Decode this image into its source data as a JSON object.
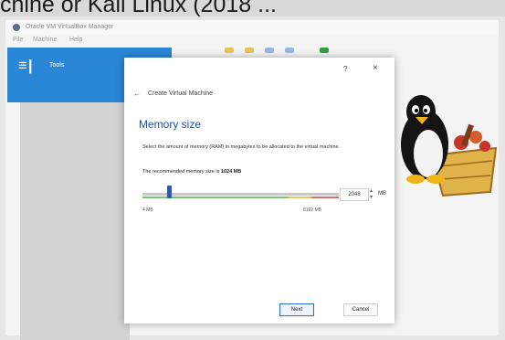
{
  "photo_caption": "chine or Kali Linux (2018 ...",
  "app": {
    "title": "Oracle VM VirtualBox Manager",
    "menu": [
      "File",
      "Machine",
      "Help"
    ],
    "tools_label": "Tools"
  },
  "dialog": {
    "help": "?",
    "close": "×",
    "back_arrow": "←",
    "wizard_title": "Create Virtual Machine",
    "heading": "Memory size",
    "description": "Select the amount of memory (RAM) in megabytes to be allocated to the virtual machine.",
    "recommended_prefix": "The recommended memory size is ",
    "recommended_value": "1024 MB",
    "slider": {
      "min_label": "4 MB",
      "max_label": "8192 MB",
      "value": 2048,
      "min": 4,
      "max": 8192
    },
    "memory_value": "2048",
    "unit": "MB",
    "next_button": "Next",
    "cancel_button": "Cancel"
  },
  "colors": {
    "accent_blue": "#2a86d7",
    "heading_blue": "#1f4fa8",
    "slider_thumb": "#1e5ec0"
  },
  "icons": [
    "app-icon",
    "tools-icon",
    "back-arrow-icon",
    "help-icon",
    "close-icon",
    "spin-arrows-icon",
    "tux-penguin-icon"
  ]
}
